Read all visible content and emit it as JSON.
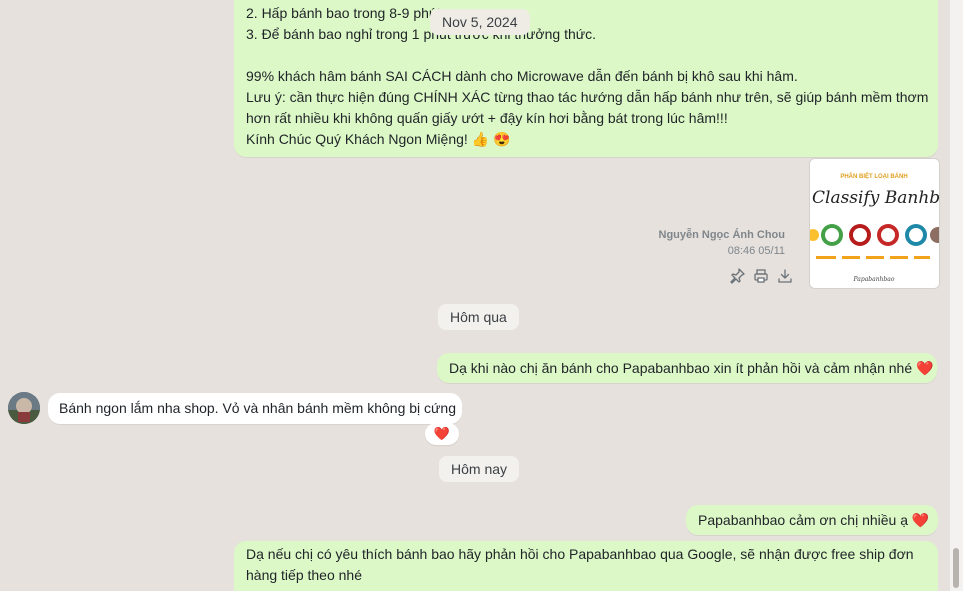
{
  "messages": {
    "top_instructions": {
      "lines": [
        "2. Hấp bánh bao trong 8-9 phút",
        "3. Để bánh bao nghỉ trong 1 phút trước khi thưởng thức.",
        "",
        "99% khách hâm bánh SAI CÁCH dành cho Microwave dẫn đến bánh bị khô sau khi hâm.",
        "Lưu ý: cần thực hiện đúng CHÍNH XÁC từng thao tác hướng dẫn hấp bánh như trên, sẽ giúp bánh mềm thơm",
        "hơn rất nhiều khi không quấn giấy ướt + đậy kín hơi bằng bát trong lúc hâm!!!",
        "Kính Chúc Quý Khách Ngon Miệng! 👍 😍"
      ]
    },
    "floating_date": "Nov 5, 2024",
    "image_message": {
      "sender": "Nguyễn Ngọc Ánh Chou",
      "time": "08:46 05/11",
      "image_heading": "PHÂN BIỆT LOẠI BÁNH",
      "image_title": "Classify Banhbao",
      "image_signature": "Papabanhbao",
      "actions": [
        "pin-icon",
        "print-icon",
        "download-icon"
      ]
    },
    "divider_yesterday": "Hôm qua",
    "out_1": "Dạ khi nào chị ăn bánh cho Papabanhbao xin ít phản hồi và cảm nhận nhé ❤️",
    "in_1": "Bánh ngon lắm nha shop. Vỏ và nhân bánh mềm không bị cứng",
    "in_1_reaction": "❤️",
    "divider_today": "Hôm nay",
    "out_2": "Papabanhbao cảm ơn chị nhiều ạ ❤️",
    "out_3": {
      "lines": [
        "Dạ nếu chị có yêu thích bánh bao hãy phản hồi cho Papabanhbao qua Google, sẽ nhận được free ship đơn",
        "hàng tiếp theo nhé"
      ]
    }
  },
  "colors": {
    "background": "#e6e1dc",
    "outgoing_bubble": "#dcf8c6",
    "incoming_bubble": "#ffffff",
    "heart": "#e0245e"
  }
}
